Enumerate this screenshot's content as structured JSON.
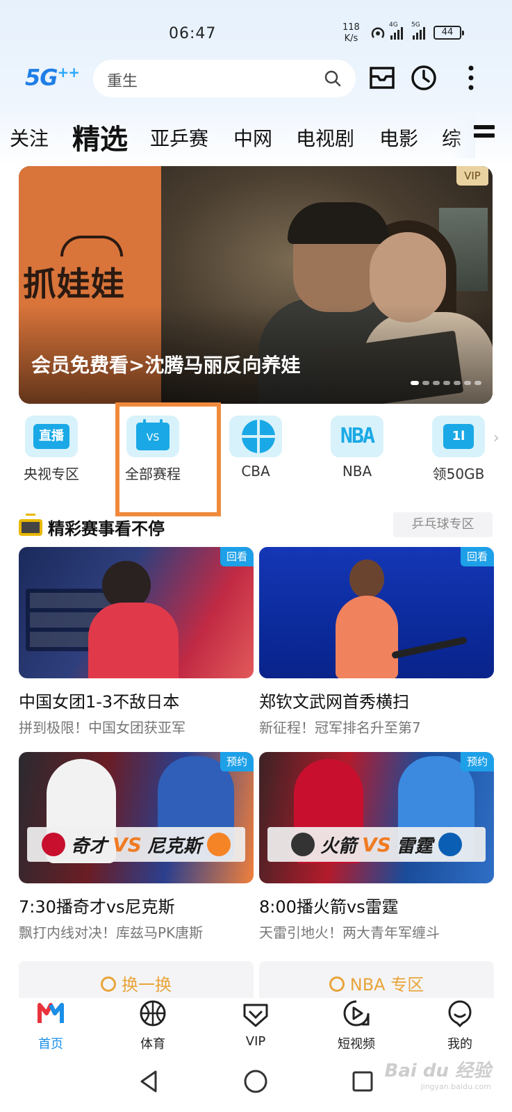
{
  "status_bar": {
    "time": "06:47",
    "net_speed_value": "118",
    "net_speed_unit": "K/s",
    "signal1_label": "4G",
    "signal2_label": "5G",
    "battery": "44"
  },
  "header": {
    "logo_text": "5G",
    "logo_sup": "++",
    "search_text": "重生"
  },
  "tabs": [
    {
      "label": "关注"
    },
    {
      "label": "精选"
    },
    {
      "label": "亚乒赛"
    },
    {
      "label": "中网"
    },
    {
      "label": "电视剧"
    },
    {
      "label": "电影"
    },
    {
      "label": "综"
    }
  ],
  "banner": {
    "logo_text": "抓娃娃",
    "caption": "会员免费看>沈腾马丽反向养娃",
    "badge": "VIP"
  },
  "quick_entries": [
    {
      "label": "央视专区",
      "icon_text": "直播",
      "icon": "live-icon"
    },
    {
      "label": "全部赛程",
      "icon_text": "VS",
      "icon": "calendar-vs-icon"
    },
    {
      "label": "CBA",
      "icon_text": "",
      "icon": "basketball-icon"
    },
    {
      "label": "NBA",
      "icon_text": "NBA",
      "icon": "nba-icon"
    },
    {
      "label": "领50GB",
      "icon_text": "1l",
      "icon": "data-package-icon"
    }
  ],
  "section": {
    "title": "精彩赛事看不停",
    "link": "乒乓球专区"
  },
  "cards": [
    {
      "tag": "回看",
      "title": "中国女团1-3不敌日本",
      "sub": "拼到极限！中国女团获亚军"
    },
    {
      "tag": "回看",
      "title": "郑钦文武网首秀横扫",
      "sub": "新征程！冠军排名升至第7"
    },
    {
      "tag": "预约",
      "title": "7:30播奇才vs尼克斯",
      "sub": "飘打内线对决！库兹马PK唐斯",
      "team_a": "奇才",
      "team_b": "尼克斯",
      "vs": "VS"
    },
    {
      "tag": "预约",
      "title": "8:00播火箭vs雷霆",
      "sub": "天雷引地火！两大青年军缠斗",
      "team_a": "火箭",
      "team_b": "雷霆",
      "vs": "VS"
    }
  ],
  "actions": {
    "refresh": "换一换",
    "nba_zone": "NBA 专区"
  },
  "bottom_nav": [
    {
      "label": "首页",
      "icon": "home-icon",
      "active": true
    },
    {
      "label": "体育",
      "icon": "basketball-icon"
    },
    {
      "label": "VIP",
      "icon": "vip-icon"
    },
    {
      "label": "短视频",
      "icon": "short-video-icon"
    },
    {
      "label": "我的",
      "icon": "profile-icon"
    }
  ],
  "watermark": {
    "text": "Bai du 经验",
    "sub": "jingyan.baidu.com"
  },
  "colors": {
    "accent_blue": "#1da0e8",
    "highlight_orange": "#f08a3c",
    "action_gold": "#e8a43a",
    "vip_gold": "#e9d2a0"
  }
}
